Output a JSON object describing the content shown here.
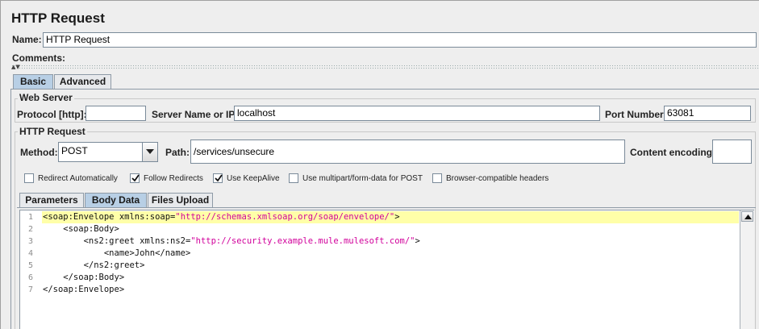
{
  "title": "HTTP Request",
  "name_label": "Name:",
  "name_value": "HTTP Request",
  "comments_label": "Comments:",
  "top_tabs": [
    {
      "label": "Basic",
      "active": true
    },
    {
      "label": "Advanced",
      "active": false
    }
  ],
  "web_server": {
    "group_title": "Web Server",
    "protocol_label": "Protocol [http]:",
    "protocol_value": "",
    "server_label": "Server Name or IP:",
    "server_value": "localhost",
    "port_label": "Port Number:",
    "port_value": "63081"
  },
  "http_request": {
    "group_title": "HTTP Request",
    "method_label": "Method:",
    "method_value": "POST",
    "path_label": "Path:",
    "path_value": "/services/unsecure",
    "encoding_label": "Content encoding:",
    "encoding_value": ""
  },
  "options": [
    {
      "label": "Redirect Automatically",
      "checked": false
    },
    {
      "label": "Follow Redirects",
      "checked": true
    },
    {
      "label": "Use KeepAlive",
      "checked": true
    },
    {
      "label": "Use multipart/form-data for POST",
      "checked": false
    },
    {
      "label": "Browser-compatible headers",
      "checked": false
    }
  ],
  "body_tabs": [
    {
      "label": "Parameters",
      "active": false
    },
    {
      "label": "Body Data",
      "active": true
    },
    {
      "label": "Files Upload",
      "active": false
    }
  ],
  "code_lines": [
    {
      "num": "1",
      "parts": [
        {
          "t": "<soap:Envelope xmlns:soap=",
          "k": "tag"
        },
        {
          "t": "\"http://schemas.xmlsoap.org/soap/envelope/\"",
          "k": "str"
        },
        {
          "t": ">",
          "k": "tag"
        }
      ]
    },
    {
      "num": "2",
      "parts": [
        {
          "t": "    <soap:Body>",
          "k": "tag"
        }
      ]
    },
    {
      "num": "3",
      "parts": [
        {
          "t": "        <ns2:greet xmlns:ns2=",
          "k": "tag"
        },
        {
          "t": "\"http://security.example.mule.mulesoft.com/\"",
          "k": "str"
        },
        {
          "t": ">",
          "k": "tag"
        }
      ]
    },
    {
      "num": "4",
      "parts": [
        {
          "t": "            <name>John</name>",
          "k": "tag"
        }
      ]
    },
    {
      "num": "5",
      "parts": [
        {
          "t": "        </ns2:greet>",
          "k": "tag"
        }
      ]
    },
    {
      "num": "6",
      "parts": [
        {
          "t": "    </soap:Body>",
          "k": "tag"
        }
      ]
    },
    {
      "num": "7",
      "parts": [
        {
          "t": "</soap:Envelope>",
          "k": "tag"
        }
      ]
    }
  ],
  "colors": {
    "active_tab": "#b8cfe5",
    "highlight_line": "#ffffa8",
    "string": "#d1009b"
  }
}
